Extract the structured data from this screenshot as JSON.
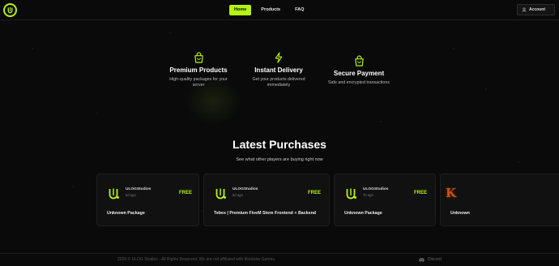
{
  "nav": {
    "logo_icon": "ulog-logo-icon",
    "items": [
      {
        "label": "Home",
        "active": true
      },
      {
        "label": "Products",
        "active": false
      },
      {
        "label": "FAQ",
        "active": false
      }
    ],
    "account_label": "Account",
    "account_icon": "user-icon"
  },
  "features": [
    {
      "icon": "shopping-bag-icon",
      "title": "Premium Products",
      "desc_line1": "High-quality packages for your",
      "desc_line2": "server"
    },
    {
      "icon": "lightning-bolt-icon",
      "title": "Instant Delivery",
      "desc_line1": "Get your products delivered",
      "desc_line2": "immediately"
    },
    {
      "icon": "shopping-bag-icon",
      "title": "Secure Payment",
      "desc_line1": "Safe and encrypted transactions",
      "desc_line2": ""
    }
  ],
  "latest": {
    "title": "Latest Purchases",
    "subtitle": "See what other players are buying right now"
  },
  "purchases": [
    {
      "seller": "ULOGStudios",
      "time": "5d ago",
      "price": "FREE",
      "product": "Unknown Package"
    },
    {
      "seller": "ULOGStudios",
      "time": "5d ago",
      "price": "FREE",
      "product": "Tebex | Premium FiveM Store Frontend + Backend"
    },
    {
      "seller": "ULOGStudios",
      "time": "7h ago",
      "price": "FREE",
      "product": "Unknown Package"
    },
    {
      "thumb_letter": "K",
      "product": "Unknown"
    }
  ],
  "footer": {
    "copyright": "2025 © ULOG Studios - All Rights Reserved. We are not affiliated with Rockstar Games.",
    "discord_label": "Discord",
    "discord_icon": "discord-icon"
  },
  "colors": {
    "accent": "#b5f312",
    "background": "#0a0a0a",
    "card": "#111111"
  }
}
